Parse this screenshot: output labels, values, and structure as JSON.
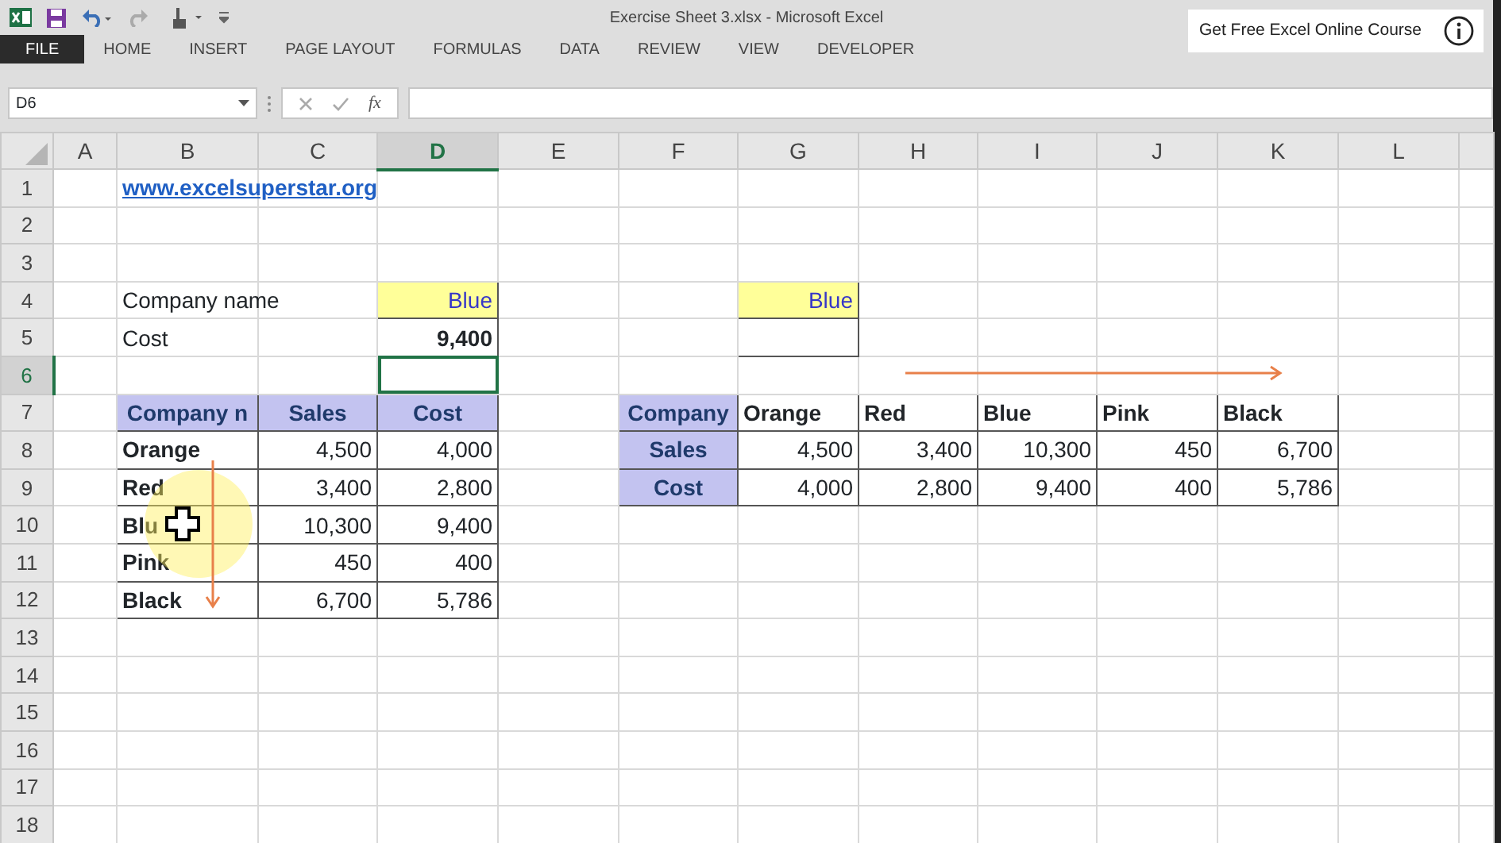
{
  "window": {
    "title": "Exercise Sheet 3.xlsx - Microsoft Excel"
  },
  "promo": {
    "text": "Get Free Excel Online Course"
  },
  "ribbon_tabs": [
    {
      "label": "FILE",
      "selected": true
    },
    {
      "label": "HOME",
      "selected": false
    },
    {
      "label": "INSERT",
      "selected": false
    },
    {
      "label": "PAGE LAYOUT",
      "selected": false
    },
    {
      "label": "FORMULAS",
      "selected": false
    },
    {
      "label": "DATA",
      "selected": false
    },
    {
      "label": "REVIEW",
      "selected": false
    },
    {
      "label": "VIEW",
      "selected": false
    },
    {
      "label": "DEVELOPER",
      "selected": false
    }
  ],
  "formula_bar": {
    "name_box": "D6",
    "function_button": "fx"
  },
  "columns": [
    {
      "label": "A",
      "selected": false
    },
    {
      "label": "B",
      "selected": false
    },
    {
      "label": "C",
      "selected": false
    },
    {
      "label": "D",
      "selected": true
    },
    {
      "label": "E",
      "selected": false
    },
    {
      "label": "F",
      "selected": false
    },
    {
      "label": "G",
      "selected": false
    },
    {
      "label": "H",
      "selected": false
    },
    {
      "label": "I",
      "selected": false
    },
    {
      "label": "J",
      "selected": false
    },
    {
      "label": "K",
      "selected": false
    },
    {
      "label": "L",
      "selected": false
    }
  ],
  "rows": [
    {
      "label": "1",
      "selected": false,
      "cells": [
        null,
        {
          "kind": "link",
          "text": "www.excelsuperstar.org"
        }
      ]
    },
    {
      "label": "2",
      "selected": false,
      "cells": []
    },
    {
      "label": "3",
      "selected": false,
      "cells": []
    },
    {
      "label": "4",
      "selected": false,
      "cells": [
        null,
        {
          "kind": "text",
          "text": "Company name"
        },
        null,
        {
          "kind": "input",
          "text": "Blue"
        },
        null,
        null,
        {
          "kind": "input",
          "text": "Blue"
        }
      ]
    },
    {
      "label": "5",
      "selected": false,
      "cells": [
        null,
        {
          "kind": "text",
          "text": "Cost"
        },
        null,
        {
          "kind": "result",
          "text": "9,400"
        },
        null,
        null,
        {
          "kind": "box"
        }
      ]
    },
    {
      "label": "6",
      "selected": true,
      "cells": []
    },
    {
      "label": "7",
      "selected": false,
      "cells": [
        null,
        {
          "kind": "header",
          "text": "Company n"
        },
        {
          "kind": "header",
          "text": "Sales"
        },
        {
          "kind": "header",
          "text": "Cost"
        },
        null,
        {
          "kind": "header",
          "text": "Company"
        },
        {
          "kind": "name",
          "text": "Orange"
        },
        {
          "kind": "name",
          "text": "Red"
        },
        {
          "kind": "name",
          "text": "Blue"
        },
        {
          "kind": "name",
          "text": "Pink"
        },
        {
          "kind": "name",
          "text": "Black"
        }
      ]
    },
    {
      "label": "8",
      "selected": false,
      "cells": [
        null,
        {
          "kind": "name",
          "text": "Orange"
        },
        {
          "kind": "number",
          "text": "4,500"
        },
        {
          "kind": "number",
          "text": "4,000"
        },
        null,
        {
          "kind": "header",
          "text": "Sales"
        },
        {
          "kind": "number",
          "text": "4,500"
        },
        {
          "kind": "number",
          "text": "3,400"
        },
        {
          "kind": "number",
          "text": "10,300"
        },
        {
          "kind": "number",
          "text": "450"
        },
        {
          "kind": "number",
          "text": "6,700"
        }
      ]
    },
    {
      "label": "9",
      "selected": false,
      "cells": [
        null,
        {
          "kind": "name",
          "text": "Red"
        },
        {
          "kind": "number",
          "text": "3,400"
        },
        {
          "kind": "number",
          "text": "2,800"
        },
        null,
        {
          "kind": "header",
          "text": "Cost"
        },
        {
          "kind": "number",
          "text": "4,000"
        },
        {
          "kind": "number",
          "text": "2,800"
        },
        {
          "kind": "number",
          "text": "9,400"
        },
        {
          "kind": "number",
          "text": "400"
        },
        {
          "kind": "number",
          "text": "5,786"
        }
      ]
    },
    {
      "label": "10",
      "selected": false,
      "cells": [
        null,
        {
          "kind": "name",
          "text": "Blu"
        },
        {
          "kind": "number",
          "text": "10,300"
        },
        {
          "kind": "number",
          "text": "9,400"
        }
      ]
    },
    {
      "label": "11",
      "selected": false,
      "cells": [
        null,
        {
          "kind": "name",
          "text": "Pink"
        },
        {
          "kind": "number",
          "text": "450"
        },
        {
          "kind": "number",
          "text": "400"
        }
      ]
    },
    {
      "label": "12",
      "selected": false,
      "cells": [
        null,
        {
          "kind": "name",
          "text": "Black"
        },
        {
          "kind": "number",
          "text": "6,700"
        },
        {
          "kind": "number",
          "text": "5,786"
        }
      ]
    },
    {
      "label": "13",
      "selected": false,
      "cells": []
    },
    {
      "label": "14",
      "selected": false,
      "cells": []
    },
    {
      "label": "15",
      "selected": false,
      "cells": []
    },
    {
      "label": "16",
      "selected": false,
      "cells": []
    },
    {
      "label": "17",
      "selected": false,
      "cells": []
    },
    {
      "label": "18",
      "selected": false,
      "cells": []
    }
  ]
}
